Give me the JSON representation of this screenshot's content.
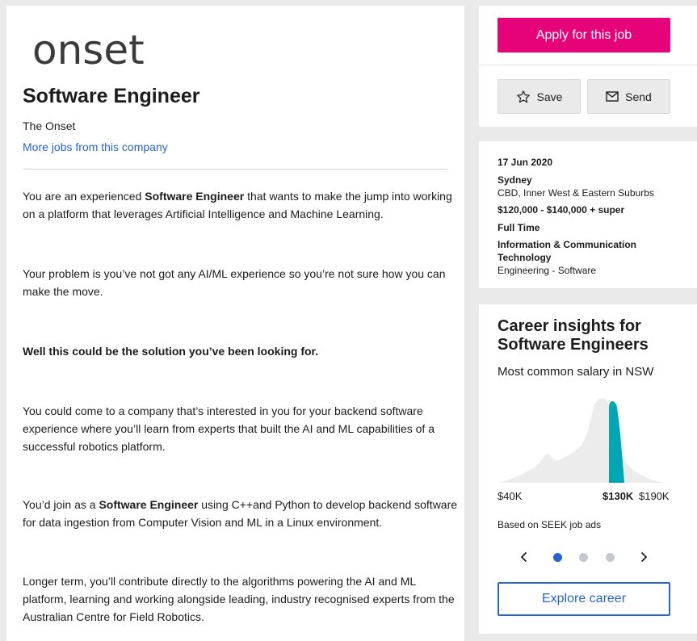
{
  "company_logo_text": "onset",
  "job": {
    "title": "Software Engineer",
    "company": "The Onset",
    "more_jobs_link": "More jobs from this company"
  },
  "description": {
    "p1_pre": "You are an experienced ",
    "p1_bold": "Software Engineer",
    "p1_post": " that wants to make the jump into working on a platform that leverages Artificial Intelligence and Machine Learning.",
    "p2": "Your problem is you’ve not got  any AI/ML experience so you’re not sure how you can make the move.",
    "p3": "Well this could be the solution you’ve been looking for.",
    "p4": "You could come to a company that’s interested in you for your backend software experience where you’ll learn from experts that built the AI and ML capabilities of a successful robotics platform.",
    "p5_pre": "You’d join as a ",
    "p5_bold": "Software Engineer",
    "p5_post": " using C++and Python to develop backend software for data ingestion from Computer Vision and ML in a Linux environment.",
    "p6": "Longer term, you’ll contribute directly to the algorithms powering the AI and ML platform, learning and working alongside leading, industry recognised experts from the Australian Centre for Field Robotics."
  },
  "actions": {
    "apply_label": "Apply for this job",
    "save_label": "Save",
    "send_label": "Send",
    "apply_color": "#e60278"
  },
  "details": {
    "date": "17 Jun 2020",
    "location": "Sydney",
    "area": "CBD, Inner West & Eastern Suburbs",
    "salary": "$120,000 - $140,000 + super",
    "work_type": "Full Time",
    "classification_line1": "Information & Communication",
    "classification_line2": "Technology",
    "sub_classification": "Engineering - Software"
  },
  "insights": {
    "title": "Career insights for Software Engineers",
    "subtitle": "Most common salary in NSW",
    "salary_min_label": "$40K",
    "salary_highlight_label": "$130K",
    "salary_max_label": "$190K",
    "highlight_color": "#00a6b2",
    "based_on": "Based on SEEK job ads",
    "carousel_active_index": 0,
    "carousel_count": 3,
    "explore_label": "Explore career",
    "accent_color": "#2765cf"
  }
}
